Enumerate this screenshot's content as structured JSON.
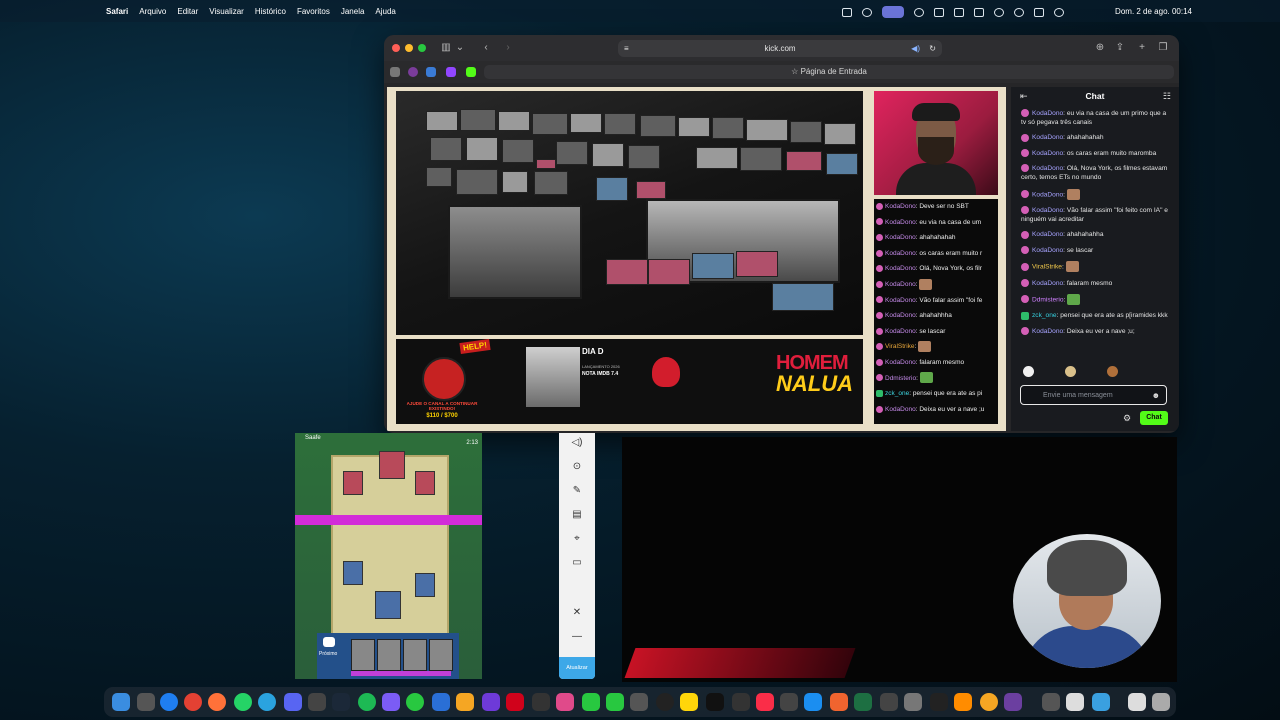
{
  "menubar": {
    "app": "Safari",
    "menus": [
      "Arquivo",
      "Editar",
      "Visualizar",
      "Histórico",
      "Favoritos",
      "Janela",
      "Ajuda"
    ],
    "clock": "Dom. 2 de ago.  00:14"
  },
  "safari": {
    "address": "kick.com",
    "tab_title": "Página de Entrada"
  },
  "stream": {
    "help_bubble": "HELP!",
    "help_text": "AJUDE O CANAL A CONTINUAR EXISTINDO!",
    "help_amount": "$110 / $700",
    "movie_title": "DIA D",
    "movie_sub": "LANÇAMENTO 2026",
    "movie_rating": "NOTA IMDB 7.4",
    "promo_top": "HOMEM",
    "promo_bottom": "NALUA",
    "overlay_chat": [
      {
        "user": "KodaDono",
        "text": "Deve ser no SBT",
        "style": ""
      },
      {
        "user": "KodaDono",
        "text": "eu via na casa de um",
        "style": ""
      },
      {
        "user": "KodaDono",
        "text": "ahahahahah",
        "style": ""
      },
      {
        "user": "KodaDono",
        "text": "os caras eram muito r",
        "style": ""
      },
      {
        "user": "KodaDono",
        "text": "Olá, Nova York, os filr",
        "style": ""
      },
      {
        "user": "KodaDono",
        "text": "",
        "style": ""
      },
      {
        "user": "KodaDono",
        "text": "Vão falar assim \"foi fe",
        "style": ""
      },
      {
        "user": "KodaDono",
        "text": "ahahahhha",
        "style": ""
      },
      {
        "user": "KodaDono",
        "text": "se lascar",
        "style": ""
      },
      {
        "user": "ViralStrike",
        "text": "",
        "style": "y"
      },
      {
        "user": "KodaDono",
        "text": "falaram mesmo",
        "style": ""
      },
      {
        "user": "Ddmisterio",
        "text": "",
        "style": ""
      },
      {
        "user": "zck_one",
        "text": "pensei que era ate as pi",
        "style": "g"
      },
      {
        "user": "KodaDono",
        "text": "Deixa eu ver a nave ;u",
        "style": ""
      }
    ]
  },
  "chat": {
    "title": "Chat",
    "messages": [
      {
        "user": "KodaDono",
        "text": "eu via na casa de um primo que a tv só pegava três canais"
      },
      {
        "user": "KodaDono",
        "text": "ahahahahah"
      },
      {
        "user": "KodaDono",
        "text": "os caras eram muito maromba"
      },
      {
        "user": "KodaDono",
        "text": "Olá, Nova York, os filmes estavam certo, temos ETs no mundo"
      },
      {
        "user": "KodaDono",
        "text": ""
      },
      {
        "user": "KodaDono",
        "text": "Vão falar assim \"foi feito com IA\" e ninguém vai acreditar"
      },
      {
        "user": "KodaDono",
        "text": "ahahahahha"
      },
      {
        "user": "KodaDono",
        "text": "se lascar"
      },
      {
        "user": "ViralStrike",
        "text": ""
      },
      {
        "user": "KodaDono",
        "text": "falaram mesmo"
      },
      {
        "user": "Ddmisterio",
        "text": ""
      },
      {
        "user": "zck_one",
        "text": "pensei que era ate as p[iramides kkk"
      },
      {
        "user": "KodaDono",
        "text": "Deixa eu ver a nave ;u;"
      }
    ],
    "input_placeholder": "Envie uma mensagem",
    "send_label": "Chat"
  },
  "phone": {
    "player": "Saafe",
    "timer": "2:13",
    "next_label": "Próximo"
  },
  "vtool": {
    "update_label": "Atualizar"
  }
}
